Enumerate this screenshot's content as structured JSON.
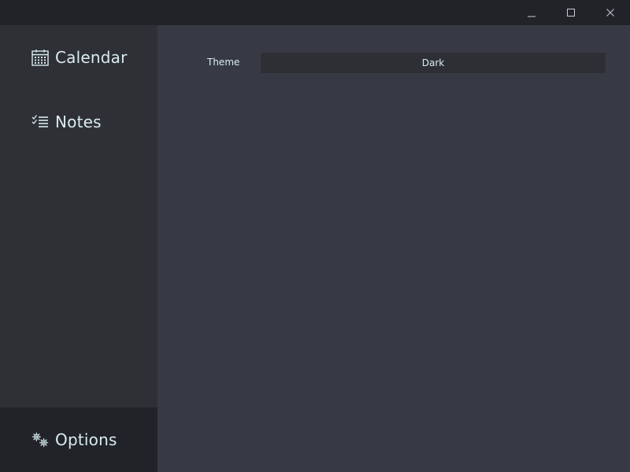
{
  "titlebar": {
    "buttons": {
      "minimize": "minimize-icon",
      "maximize": "maximize-icon",
      "close": "close-icon"
    }
  },
  "sidebar": {
    "items": [
      {
        "label": "Calendar",
        "icon": "calendar-icon"
      },
      {
        "label": "Notes",
        "icon": "checklist-icon"
      }
    ],
    "bottom_item": {
      "label": "Options",
      "icon": "gears-icon",
      "selected": true
    }
  },
  "settings": {
    "theme": {
      "label": "Theme",
      "value": "Dark"
    }
  },
  "colors": {
    "background": "#373A44",
    "sidebar": "#2F3036",
    "titlebar": "#222329",
    "selected_nav": "#222329",
    "text": "#D7EDF1",
    "select_bg": "#2E2F35"
  }
}
